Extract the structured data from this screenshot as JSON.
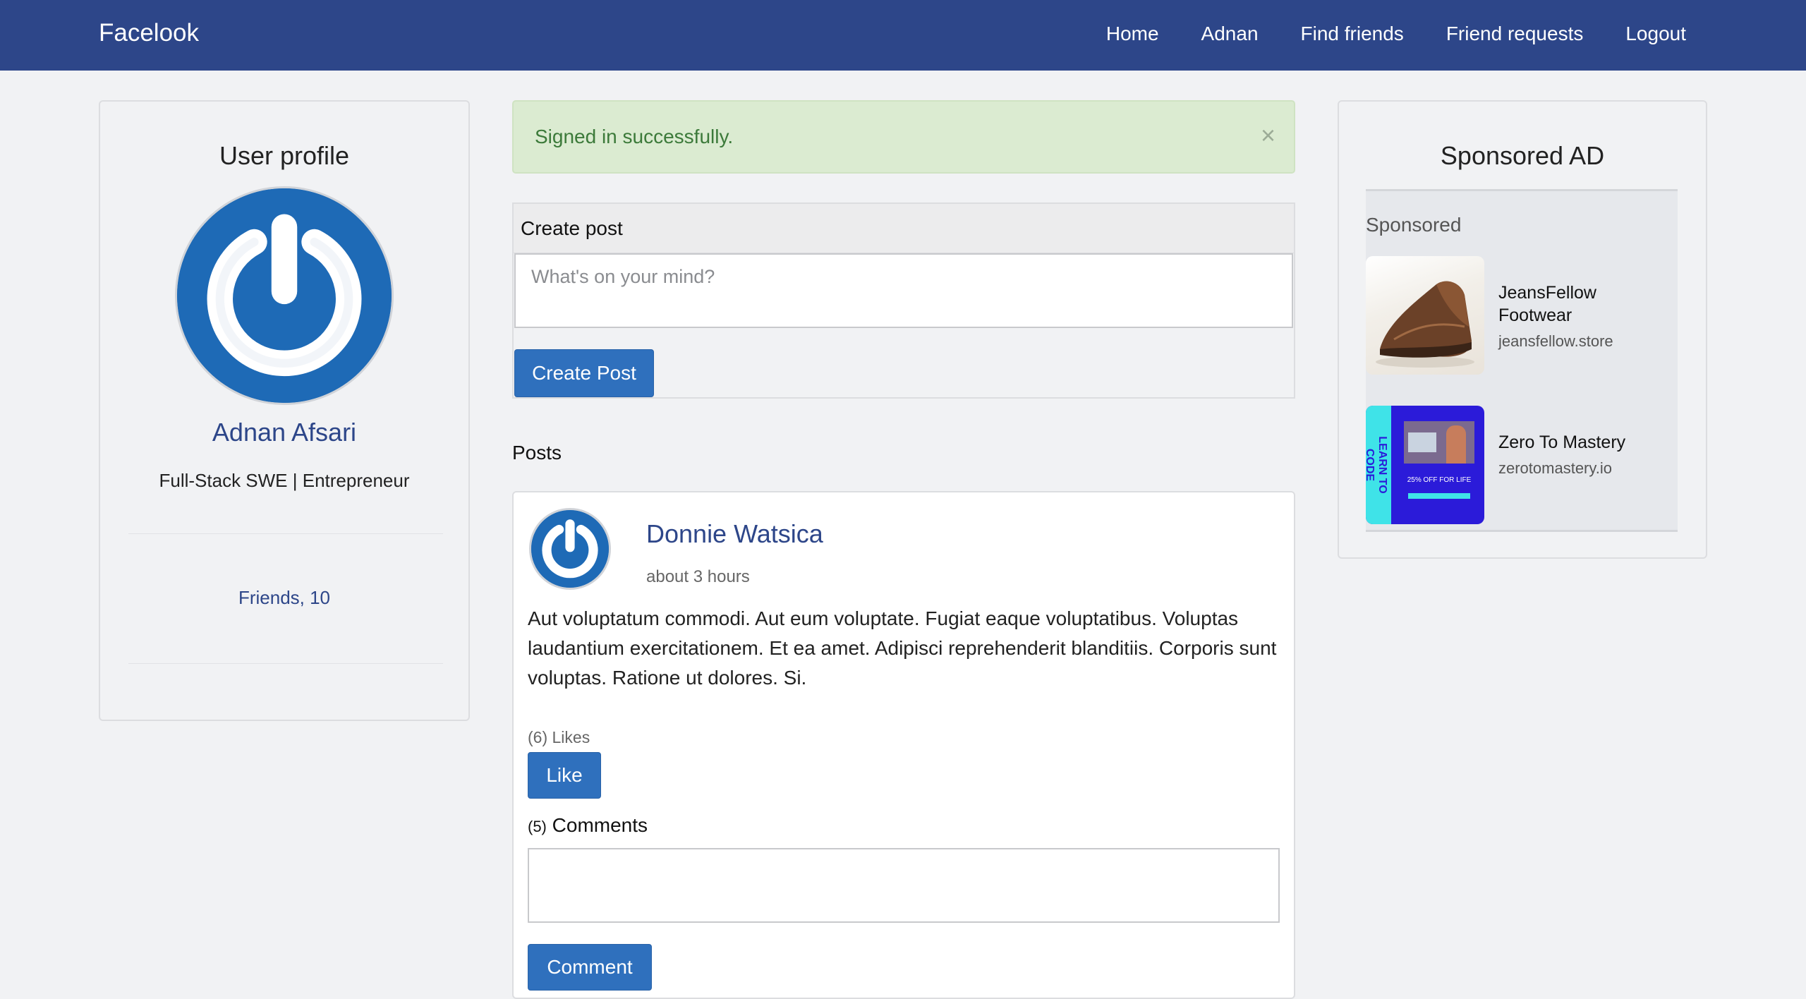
{
  "navbar": {
    "brand": "Facelook",
    "links": [
      "Home",
      "Adnan",
      "Find friends",
      "Friend requests",
      "Logout"
    ],
    "bg_color": "#2d4689"
  },
  "profile": {
    "title": "User profile",
    "name": "Adnan Afsari",
    "bio": "Full-Stack SWE | Entrepreneur",
    "friends": "Friends, 10"
  },
  "alert": {
    "message": "Signed in successfully.",
    "close": "×"
  },
  "create_post": {
    "title": "Create post",
    "placeholder": "What's on your mind?",
    "button": "Create Post"
  },
  "posts": {
    "heading": "Posts",
    "items": [
      {
        "author": "Donnie Watsica",
        "time": "about 3 hours",
        "body": "Aut voluptatum commodi. Aut eum voluptate. Fugiat eaque voluptatibus. Voluptas laudantium exercitationem. Et ea amet. Adipisci reprehenderit blanditiis. Corporis sunt voluptas. Ratione ut dolores. Si.",
        "likes": "(6) Likes",
        "like_button": "Like",
        "comments_count": "(5)",
        "comments_label": "Comments",
        "comment_button": "Comment"
      }
    ]
  },
  "sponsored": {
    "title": "Sponsored AD",
    "label": "Sponsored",
    "ads": [
      {
        "title_line1": "JeansFellow",
        "title_line2": "Footwear",
        "domain": "jeansfellow.store"
      },
      {
        "title_line1": "Zero To Mastery",
        "domain": "zerotomastery.io",
        "banner_text": "LEARN TO CODE",
        "promo": "25% OFF FOR LIFE"
      }
    ]
  }
}
